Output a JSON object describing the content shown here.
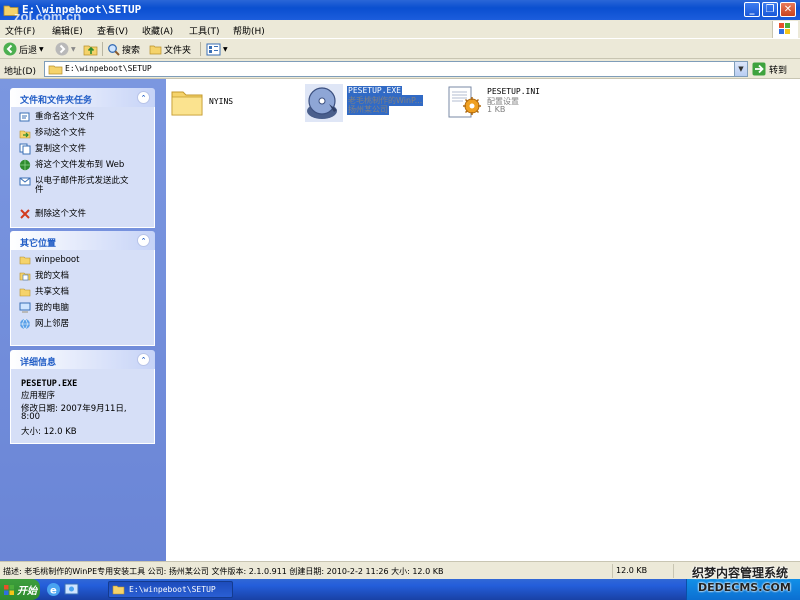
{
  "window": {
    "title": "E:\\winpeboot\\SETUP",
    "watermark": "zol.com.cn",
    "buttons": [
      "minimize",
      "restore",
      "close"
    ]
  },
  "menu": {
    "items": [
      "文件(F)",
      "编辑(E)",
      "查看(V)",
      "收藏(A)",
      "工具(T)",
      "帮助(H)"
    ]
  },
  "toolbar": {
    "back_label": "后退",
    "search_label": "搜索",
    "folders_label": "文件夹"
  },
  "address": {
    "label": "地址(D)",
    "value": "E:\\winpeboot\\SETUP",
    "go_label": "转到"
  },
  "sidebar": {
    "file_tasks": {
      "title": "文件和文件夹任务",
      "items": [
        {
          "label": "重命名这个文件",
          "icon": "rename-icon"
        },
        {
          "label": "移动这个文件",
          "icon": "move-icon"
        },
        {
          "label": "复制这个文件",
          "icon": "copy-icon"
        },
        {
          "label": "将这个文件发布到 Web",
          "icon": "publish-web-icon"
        },
        {
          "label": "以电子邮件形式发送此文件",
          "icon": "email-icon"
        },
        {
          "label": "删除这个文件",
          "icon": "delete-icon"
        }
      ]
    },
    "other_places": {
      "title": "其它位置",
      "items": [
        {
          "label": "winpeboot",
          "icon": "folder-icon"
        },
        {
          "label": "我的文档",
          "icon": "my-documents-icon"
        },
        {
          "label": "共享文档",
          "icon": "shared-documents-icon"
        },
        {
          "label": "我的电脑",
          "icon": "my-computer-icon"
        },
        {
          "label": "网上邻居",
          "icon": "network-places-icon"
        }
      ]
    },
    "details": {
      "title": "详细信息",
      "name": "PESETUP.EXE",
      "type": "应用程序",
      "modified_line1": "修改日期: 2007年9月11日,",
      "modified_line2": "8:00",
      "size": "大小: 12.0 KB"
    }
  },
  "files": [
    {
      "name": "NYINS",
      "type": "folder"
    },
    {
      "name": "PESETUP.EXE",
      "line2": "老毛桃制作的WinP...",
      "line3": "扬州某公司",
      "type": "exe",
      "selected": true
    },
    {
      "name": "PESETUP.INI",
      "line2": "配置设置",
      "line3": "1 KB",
      "type": "ini"
    }
  ],
  "statusbar": {
    "description": "描述: 老毛桃制作的WinPE专用安装工具 公司: 扬州某公司 文件版本: 2.1.0.911 创建日期: 2010-2-2 11:26 大小: 12.0 KB",
    "size": "12.0 KB"
  },
  "taskbar": {
    "start_label": "开始",
    "window_button": "E:\\winpeboot\\SETUP"
  },
  "watermark": {
    "line1": "织梦内容管理系统",
    "line2": "DEDECMS.COM"
  }
}
